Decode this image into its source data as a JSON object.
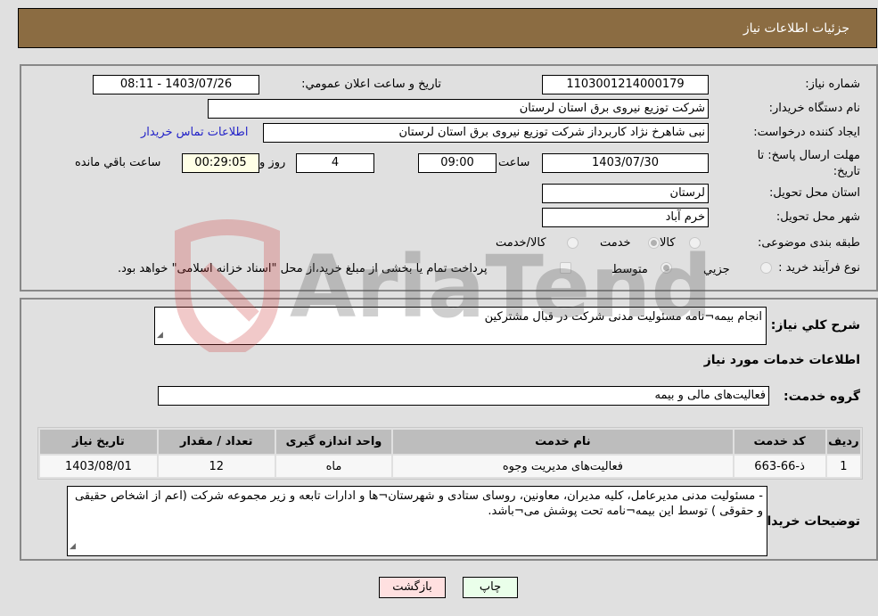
{
  "header": {
    "title": "جزئیات اطلاعات نیاز"
  },
  "form": {
    "need_number": {
      "label": "شماره نیاز:",
      "value": "1103001214000179"
    },
    "announce_datetime": {
      "label": "تاريخ و ساعت اعلان عمومي:",
      "value": "1403/07/26 - 08:11"
    },
    "buyer_org": {
      "label": "نام دستگاه خريدار:",
      "value": "شرکت توزیع نیروی برق استان لرستان"
    },
    "creator": {
      "label": "ايجاد کننده درخواست:",
      "value": "نبی شاهرخ نژاد کاربرداز شرکت توزیع نیروی برق استان لرستان",
      "contact_link": "اطلاعات تماس خريدار"
    },
    "deadline": {
      "label_line1": "مهلت ارسال پاسخ: تا",
      "label_line2": "تاريخ:",
      "date": "1403/07/30",
      "time_label": "ساعت",
      "time": "09:00",
      "days": "4",
      "days_label": "روز و",
      "remaining": "00:29:05",
      "remaining_label": "ساعت باقي مانده"
    },
    "province": {
      "label": "استان محل تحویل:",
      "value": "لرستان"
    },
    "city": {
      "label": "شهر محل تحویل:",
      "value": "خرم آباد"
    },
    "category": {
      "label": "طبقه بندی موضوعی:",
      "options": [
        "کالا",
        "خدمت",
        "کالا/خدمت"
      ],
      "selected": "خدمت"
    },
    "process_type": {
      "label": "نوع فرآیند خرید :",
      "options": [
        "جزيي",
        "متوسط"
      ],
      "selected": "متوسط",
      "checkbox_label": "پرداخت تمام یا بخشی از مبلغ خرید،از محل \"اسناد خزانه اسلامی\" خواهد بود.",
      "checkbox_checked": false
    }
  },
  "details": {
    "summary_label": "شرح كلي نياز:",
    "summary_value": "انجام بیمه¬نامه مسئولیت مدنی شرکت در قبال مشترکین",
    "services_heading": "اطلاعات خدمات مورد نياز",
    "service_group_label": "گروه خدمت:",
    "service_group_value": "فعالیت‌های مالی و بیمه",
    "table": {
      "headers": [
        "رديف",
        "كد خدمت",
        "نام خدمت",
        "واحد اندازه گيری",
        "تعداد / مقدار",
        "تاريخ نياز"
      ],
      "rows": [
        [
          "1",
          "ذ-66-663",
          "فعالیت‌های مدیریت وجوه",
          "ماه",
          "12",
          "1403/08/01"
        ]
      ]
    },
    "buyer_notes_label": "توضيحات خريدار:",
    "buyer_notes_value": "-  مسئولیت مدنی مدیرعامل، کلیه مدیران، معاونین، روسای ستادی و شهرستان¬ها و ادارات تابعه و زیر مجموعه شرکت (اعم از اشخاص حقیقی و حقوقی ) توسط این بیمه¬نامه تحت پوشش می¬باشد."
  },
  "buttons": {
    "print": "چاپ",
    "back": "بازگشت"
  },
  "watermark": {
    "text": "AriaTender.neT"
  }
}
